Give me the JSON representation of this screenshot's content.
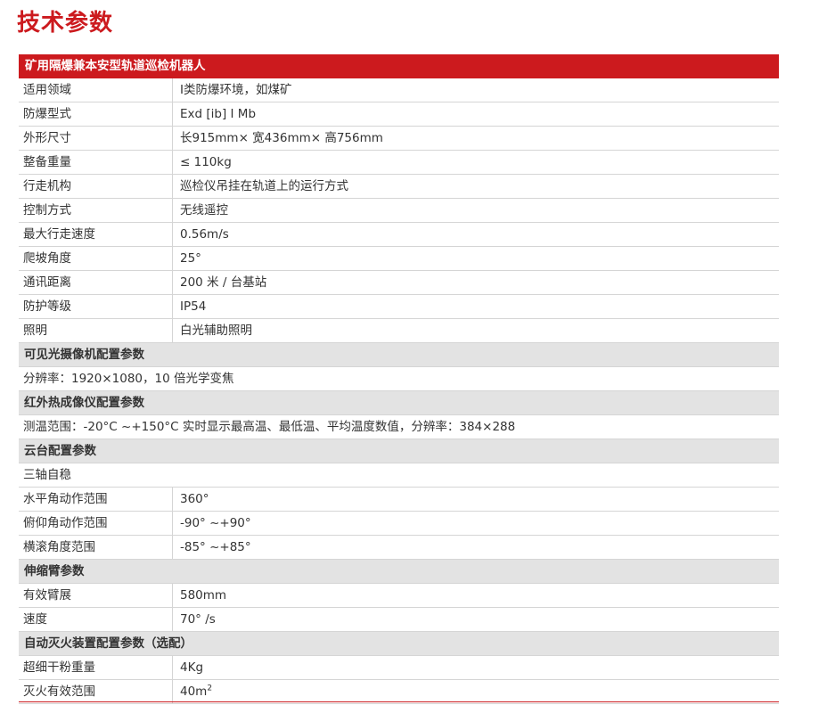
{
  "page_title": "技术参数",
  "table_header": "矿用隔爆兼本安型轨道巡检机器人",
  "basic_rows": [
    {
      "label": "适用领域",
      "value": "Ⅰ类防爆环境，如煤矿"
    },
    {
      "label": "防爆型式",
      "value": "Exd [ib] Ⅰ Mb"
    },
    {
      "label": "外形尺寸",
      "value": "长915mm× 宽436mm× 高756mm"
    },
    {
      "label": "整备重量",
      "value": "≤ 110kg"
    },
    {
      "label": "行走机构",
      "value": "巡检仪吊挂在轨道上的运行方式"
    },
    {
      "label": "控制方式",
      "value": "无线遥控"
    },
    {
      "label": "最大行走速度",
      "value": "0.56m/s"
    },
    {
      "label": "爬坡角度",
      "value": "25°"
    },
    {
      "label": "通讯距离",
      "value": "200 米 / 台基站"
    },
    {
      "label": "防护等级",
      "value": "IP54"
    },
    {
      "label": "照明",
      "value": "白光辅助照明"
    }
  ],
  "visible_camera": {
    "title": "可见光摄像机配置参数",
    "text": "分辨率：1920×1080，10 倍光学变焦"
  },
  "infrared": {
    "title": "红外热成像仪配置参数",
    "text": "测温范围：-20°C ~+150°C  实时显示最高温、最低温、平均温度数值，分辨率：384×288"
  },
  "gimbal": {
    "title": "云台配置参数",
    "text": "三轴自稳",
    "rows": [
      {
        "label": "水平角动作范围",
        "value": "360°"
      },
      {
        "label": "俯仰角动作范围",
        "value": "-90° ~+90°"
      },
      {
        "label": "横滚角度范围",
        "value": "-85° ~+85°"
      }
    ]
  },
  "arm": {
    "title": "伸缩臂参数",
    "rows": [
      {
        "label": "有效臂展",
        "value": "580mm"
      },
      {
        "label": "速度",
        "value": "70° /s"
      }
    ]
  },
  "extinguisher": {
    "title": "自动灭火装置配置参数（选配）",
    "rows": [
      {
        "label": "超细干粉重量",
        "value": "4Kg"
      },
      {
        "label": "灭火有效范围",
        "value": "40m",
        "sup": "2"
      }
    ]
  },
  "colors": {
    "accent": "#cc1a1e",
    "section_bg": "#e3e3e3",
    "border": "#d5d5d5",
    "text": "#333333"
  }
}
